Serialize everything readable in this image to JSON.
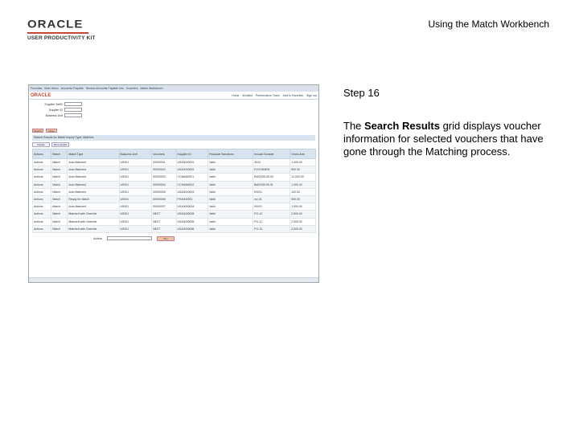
{
  "logo": {
    "brand": "ORACLE",
    "product": "USER PRODUCTIVITY KIT"
  },
  "header": {
    "title": "Using the Match Workbench"
  },
  "step": {
    "label": "Step 16"
  },
  "description": {
    "before": "The ",
    "bold": "Search Results",
    "after": " grid displays voucher information for selected vouchers that have gone through the Matching process."
  },
  "colors": {
    "oracle_red": "#c74634",
    "grid_header": "#d7e3ef",
    "button": "#e8c9a0"
  },
  "screenshot": {
    "nav_items": [
      "Favorites",
      "Main Menu",
      "Accounts Payable",
      "Review Accounts Payable Info",
      "Vouchers",
      "Match Workbench"
    ],
    "mini_logo": "ORACLE",
    "top_links": [
      "Home",
      "Worklist",
      "Performance Trace",
      "Add to Favorites",
      "Sign out"
    ],
    "form_fields": [
      "Supplier SetID",
      "Supplier ID",
      "Business Unit"
    ],
    "buttons": [
      "Search",
      "Clear"
    ],
    "section_title": "Search Results for Match Inquiry Type: Matches",
    "tabs": [
      "Details",
      "More Details"
    ],
    "columns": [
      "Actions",
      "Match",
      "Match Type",
      "Business Unit",
      "Vouchers",
      "Supplier ID",
      "Financial Sanctions",
      "Invoice Number",
      "Gross Amt"
    ],
    "rows": [
      [
        "Actions",
        "Match",
        "Auto Matched",
        "US001",
        "00000001",
        "USA0000001",
        "Valid",
        "3024",
        "1,000.00"
      ],
      [
        "Actions",
        "Match",
        "Auto Matched",
        "US001",
        "00000002",
        "USA0000002",
        "Valid",
        "FOX15NEW",
        "500.00"
      ],
      [
        "Actions",
        "Match",
        "Auto Matched",
        "US001",
        "00000003",
        "CCMAN0001",
        "Valid",
        "BW2005-05-30",
        "12,000.00"
      ],
      [
        "Actions",
        "Match",
        "Auto Matched",
        "US001",
        "00000004",
        "CCMAN0002",
        "Valid",
        "BW2005-05-31",
        "1,000.00"
      ],
      [
        "Actions",
        "Match",
        "Auto Matched",
        "US001",
        "00000005",
        "USA0000003",
        "Valid",
        "INV01",
        "100.00"
      ],
      [
        "Actions",
        "Match",
        "Ready for Match",
        "US001",
        "00000006",
        "PHA000001",
        "Valid",
        "inv-01",
        "500.00"
      ],
      [
        "Actions",
        "Match",
        "Auto Matched",
        "US001",
        "00000007",
        "USA0000004",
        "Valid",
        "INV01",
        "1,000.00"
      ],
      [
        "Actions",
        "Match",
        "Matched with Override",
        "US001",
        "NEXT",
        "USA0000005",
        "Valid",
        "PO-10",
        "2,500.00"
      ],
      [
        "Actions",
        "Match",
        "Matched with Override",
        "US001",
        "NEXT",
        "USA0000005",
        "Valid",
        "PO-11",
        "2,500.00"
      ],
      [
        "Actions",
        "Match",
        "Matched with Override",
        "US001",
        "NEXT",
        "USA0000006",
        "Valid",
        "PO-12",
        "2,500.00"
      ]
    ],
    "action_label": "Action",
    "run_button": "Run"
  }
}
